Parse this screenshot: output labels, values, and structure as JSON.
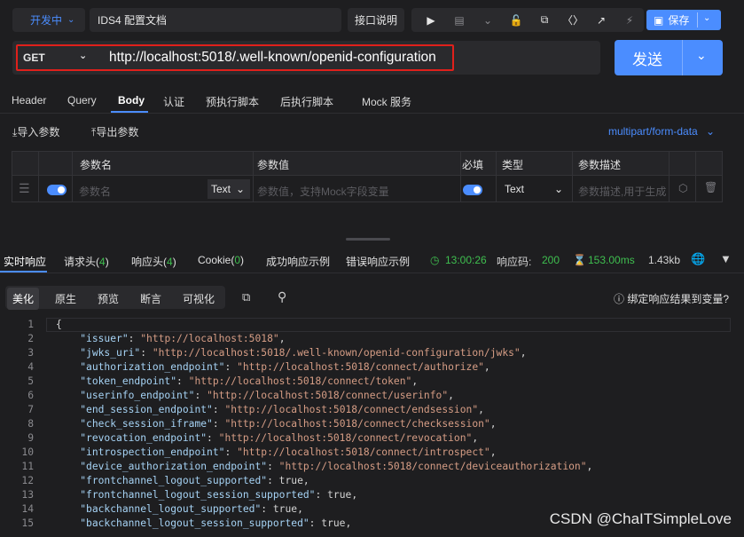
{
  "header": {
    "env_label": "开发中",
    "doc_title": "IDS4 配置文档",
    "api_desc_label": "接口说明",
    "save_label": "保存",
    "toolbar_icons": [
      "play-icon",
      "document-icon",
      "chevron-down-icon",
      "lock-icon",
      "copy-icon",
      "code-icon",
      "share-icon",
      "flash-icon"
    ]
  },
  "request": {
    "method": "GET",
    "url": "http://localhost:5018/.well-known/openid-configuration",
    "send_label": "发送"
  },
  "request_tabs": [
    "Header",
    "Query",
    "Body",
    "认证",
    "预执行脚本",
    "后执行脚本",
    "Mock 服务"
  ],
  "active_request_tab": "Body",
  "params": {
    "import_label": "导入参数",
    "export_label": "导出参数",
    "content_type": "multipart/form-data",
    "columns": [
      "参数名",
      "参数值",
      "必填",
      "类型",
      "参数描述"
    ],
    "row": {
      "name_placeholder": "参数名",
      "value_type": "Text",
      "value_placeholder": "参数值，支持Mock字段变量",
      "type": "Text",
      "desc_placeholder": "参数描述,用于生成"
    }
  },
  "response_tabs": {
    "realtime": "实时响应",
    "req_headers": "请求头(",
    "req_headers_count": "4",
    "resp_headers": "响应头(",
    "resp_headers_count": "4",
    "cookie": "Cookie(",
    "cookie_count": "0",
    "close_paren": ")",
    "success_example": "成功响应示例",
    "error_example": "错误响应示例"
  },
  "response_stats": {
    "time": "13:00:26",
    "status_label": "响应码:",
    "status_code": "200",
    "duration": "153.00ms",
    "size": "1.43kb"
  },
  "view_tabs": [
    "美化",
    "原生",
    "预览",
    "断言",
    "可视化"
  ],
  "bind_label": "绑定响应结果到变量?",
  "code_lines": [
    {
      "n": "1",
      "key": "",
      "val": "{",
      "tail": ""
    },
    {
      "n": "2",
      "key": "\"issuer\"",
      "val": "\"http://localhost:5018\"",
      "tail": ","
    },
    {
      "n": "3",
      "key": "\"jwks_uri\"",
      "val": "\"http://localhost:5018/.well-known/openid-configuration/jwks\"",
      "tail": ","
    },
    {
      "n": "4",
      "key": "\"authorization_endpoint\"",
      "val": "\"http://localhost:5018/connect/authorize\"",
      "tail": ","
    },
    {
      "n": "5",
      "key": "\"token_endpoint\"",
      "val": "\"http://localhost:5018/connect/token\"",
      "tail": ","
    },
    {
      "n": "6",
      "key": "\"userinfo_endpoint\"",
      "val": "\"http://localhost:5018/connect/userinfo\"",
      "tail": ","
    },
    {
      "n": "7",
      "key": "\"end_session_endpoint\"",
      "val": "\"http://localhost:5018/connect/endsession\"",
      "tail": ","
    },
    {
      "n": "8",
      "key": "\"check_session_iframe\"",
      "val": "\"http://localhost:5018/connect/checksession\"",
      "tail": ","
    },
    {
      "n": "9",
      "key": "\"revocation_endpoint\"",
      "val": "\"http://localhost:5018/connect/revocation\"",
      "tail": ","
    },
    {
      "n": "10",
      "key": "\"introspection_endpoint\"",
      "val": "\"http://localhost:5018/connect/introspect\"",
      "tail": ","
    },
    {
      "n": "11",
      "key": "\"device_authorization_endpoint\"",
      "val": "\"http://localhost:5018/connect/deviceauthorization\"",
      "tail": ","
    },
    {
      "n": "12",
      "key": "\"frontchannel_logout_supported\"",
      "val": "true",
      "tail": ","
    },
    {
      "n": "13",
      "key": "\"frontchannel_logout_session_supported\"",
      "val": "true",
      "tail": ","
    },
    {
      "n": "14",
      "key": "\"backchannel_logout_supported\"",
      "val": "true",
      "tail": ","
    },
    {
      "n": "15",
      "key": "\"backchannel_logout_session_supported\"",
      "val": "true",
      "tail": ","
    }
  ],
  "watermark": "CSDN @ChaITSimpleLove",
  "colors": {
    "accent": "#4b8dff",
    "success": "#3fbf4f",
    "highlight_border": "#e0201b",
    "key": "#a6d3f5",
    "string": "#d69d85"
  }
}
